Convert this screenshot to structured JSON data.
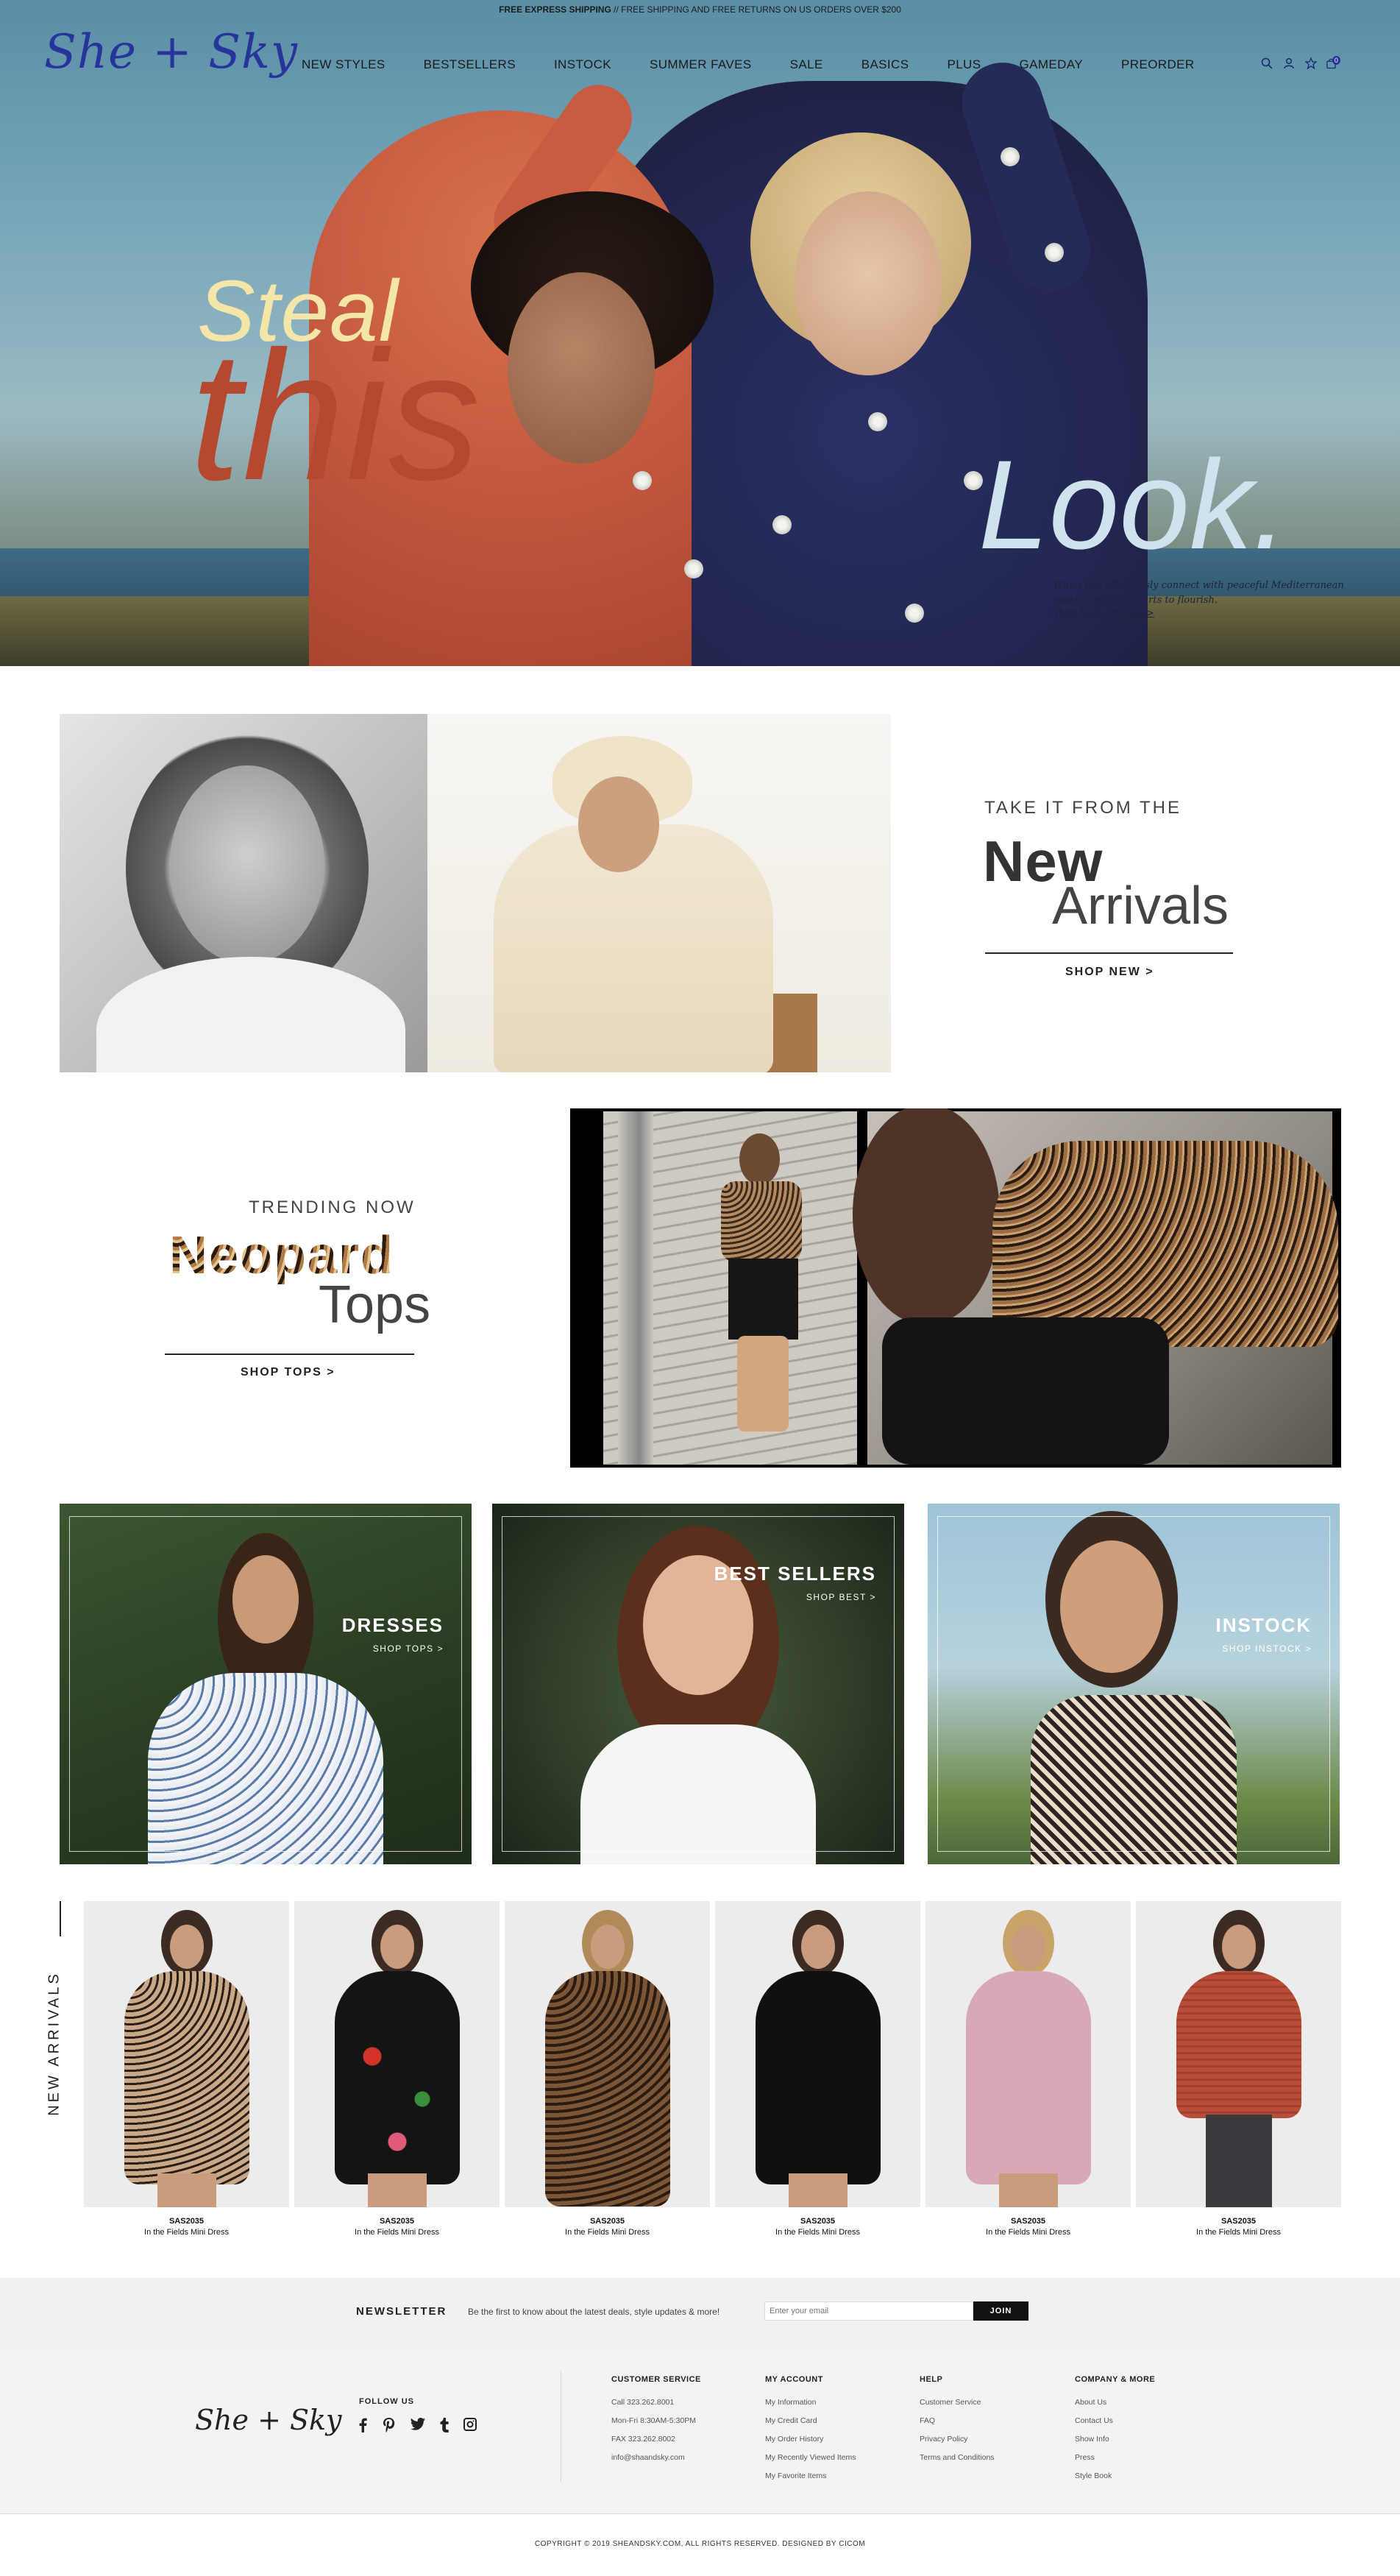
{
  "promo": {
    "bold": "FREE EXPRESS SHIPPING",
    "rest": " // FREE SHIPPING AND FREE RETURNS ON US ORDERS OVER $200"
  },
  "brand": {
    "logo": "She + Sky",
    "accent": "#27359a"
  },
  "nav": [
    "NEW STYLES",
    "BESTSELLERS",
    "INSTOCK",
    "SUMMER FAVES",
    "SALE",
    "BASICS",
    "PLUS",
    "GAMEDAY",
    "PREORDER"
  ],
  "header_icons": [
    "search-icon",
    "account-icon",
    "wishlist-icon",
    "cart-icon"
  ],
  "cart_count": "0",
  "hero": {
    "line1": "Steal",
    "line2": "this",
    "line3": "Look.",
    "copy": "When you effortlessly connect with peaceful Mediterranean spots, creativity starts to flourish.",
    "link": "Shop New Arrivals >"
  },
  "new_arrivals_promo": {
    "kicker": "TAKE IT FROM THE",
    "title1": "New",
    "title2": "Arrivals",
    "cta": "SHOP NEW >"
  },
  "trending": {
    "kicker": "TRENDING NOW",
    "title1": "Neopard",
    "title2": "Tops",
    "cta": "SHOP TOPS >"
  },
  "categories": [
    {
      "label": "DRESSES",
      "sub": "SHOP TOPS >"
    },
    {
      "label": "BEST SELLERS",
      "sub": "SHOP BEST >"
    },
    {
      "label": "INSTOCK",
      "sub": "SHOP INSTOCK >"
    }
  ],
  "carousel": {
    "heading": "NEW ARRIVALS",
    "prev": "‹",
    "next": "›",
    "products": [
      {
        "sku": "SAS2035",
        "name": "In the Fields Mini Dress",
        "color": "#c9a887"
      },
      {
        "sku": "SAS2035",
        "name": "In the Fields Mini Dress",
        "color": "#141414"
      },
      {
        "sku": "SAS2035",
        "name": "In the Fields Mini Dress",
        "color": "#7a5636"
      },
      {
        "sku": "SAS2035",
        "name": "In the Fields Mini Dress",
        "color": "#101010"
      },
      {
        "sku": "SAS2035",
        "name": "In the Fields Mini Dress",
        "color": "#d7a9b7"
      },
      {
        "sku": "SAS2035",
        "name": "In the Fields Mini Dress",
        "color": "#b84d3a"
      }
    ]
  },
  "newsletter": {
    "label": "NEWSLETTER",
    "text": "Be the first to know about the latest deals, style updates & more!",
    "placeholder": "Enter your email",
    "button": "JOIN"
  },
  "footer": {
    "logo": "She + Sky",
    "follow": "FOLLOW US",
    "socials": [
      "facebook-icon",
      "pinterest-icon",
      "twitter-icon",
      "tumblr-icon",
      "instagram-icon"
    ],
    "columns": [
      {
        "title": "CUSTOMER SERVICE",
        "links": [
          "Call 323.262.8001",
          "Mon-Fri 8:30AM-5:30PM",
          "FAX 323.262.8002",
          "info@shaandsky.com"
        ]
      },
      {
        "title": "MY ACCOUNT",
        "links": [
          "My Information",
          "My Credit Card",
          "My Order History",
          "My Recently Viewed Items",
          "My Favorite Items"
        ]
      },
      {
        "title": "HELP",
        "links": [
          "Customer Service",
          "FAQ",
          "Privacy Policy",
          "Terms and Conditions"
        ]
      },
      {
        "title": "COMPANY & MORE",
        "links": [
          "About Us",
          "Contact Us",
          "Show Info",
          "Press",
          "Style Book"
        ]
      }
    ],
    "copyright": "COPYRIGHT © 2019 SHEANDSKY.COM, ALL RIGHTS RESERVED. DESIGNED BY CICOM"
  }
}
